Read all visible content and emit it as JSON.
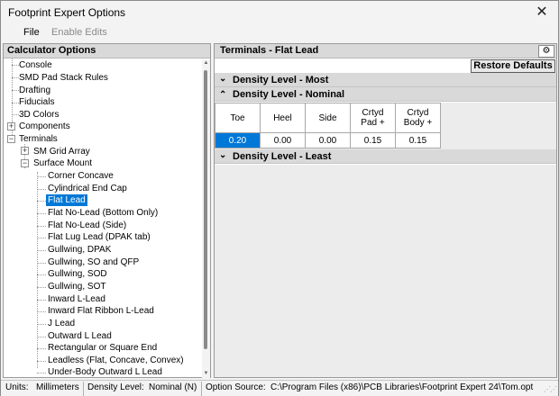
{
  "window": {
    "title": "Footprint Expert Options",
    "close_glyph": "✕"
  },
  "menu": {
    "file": "File",
    "enable_edits": "Enable Edits"
  },
  "left": {
    "header": "Calculator Options",
    "items": [
      "Console",
      "SMD Pad Stack Rules",
      "Drafting",
      "Fiducials",
      "3D Colors",
      "Components",
      "Terminals",
      "SM Grid Array",
      "Surface Mount",
      "Corner Concave",
      "Cylindrical End Cap",
      "Flat Lead",
      "Flat No-Lead (Bottom Only)",
      "Flat No-Lead (Side)",
      "Flat Lug Lead (DPAK tab)",
      "Gullwing, DPAK",
      "Gullwing, SO and QFP",
      "Gullwing, SOD",
      "Gullwing, SOT",
      "Inward L-Lead",
      "Inward Flat Ribbon L-Lead",
      "J Lead",
      "Outward L Lead",
      "Rectangular or Square End",
      "Leadless (Flat, Concave, Convex)",
      "Under-Body Outward L Lead"
    ],
    "expanders": {
      "components": "+",
      "terminals": "−",
      "sm_grid": "+",
      "surface_mount": "−"
    }
  },
  "right": {
    "header": "Terminals - Flat Lead",
    "gear_icon": "⚙",
    "restore_label": "Restore Defaults",
    "density_most": "Density Level - Most",
    "density_nominal": "Density Level - Nominal",
    "density_least": "Density Level - Least",
    "chev_down": "⌄",
    "chev_up": "⌃",
    "columns": [
      "Toe",
      "Heel",
      "Side",
      "Crtyd\nPad +",
      "Crtyd\nBody +"
    ],
    "values": [
      "0.20",
      "0.00",
      "0.00",
      "0.15",
      "0.15"
    ]
  },
  "status": {
    "units_label": "Units:",
    "units_value": "Millimeters",
    "density_label": "Density Level:",
    "density_value": "Nominal (N)",
    "source_label": "Option Source:",
    "source_value": "C:\\Program Files (x86)\\PCB Libraries\\Footprint Expert 24\\Tom.opt"
  }
}
